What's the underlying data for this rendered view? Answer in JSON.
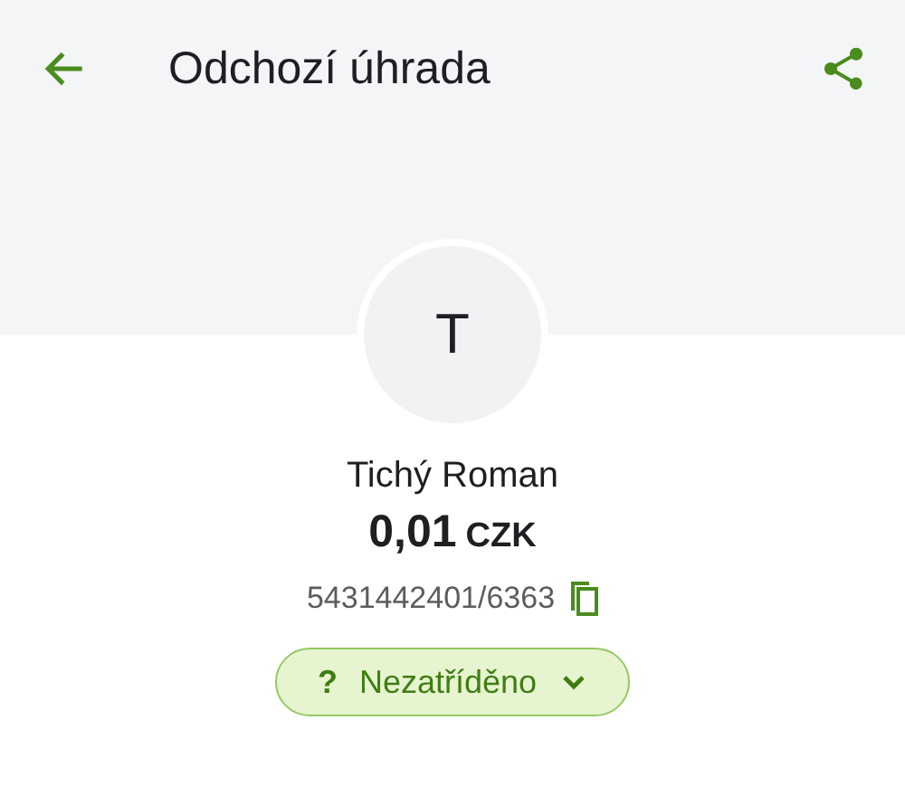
{
  "app_bar": {
    "title": "Odchozí úhrada"
  },
  "counterparty": {
    "avatar_letter": "T",
    "name": "Tichý Roman",
    "amount": "0,01",
    "currency": "CZK",
    "account": "5431442401/6363"
  },
  "category": {
    "icon": "?",
    "label": "Nezatříděno"
  }
}
